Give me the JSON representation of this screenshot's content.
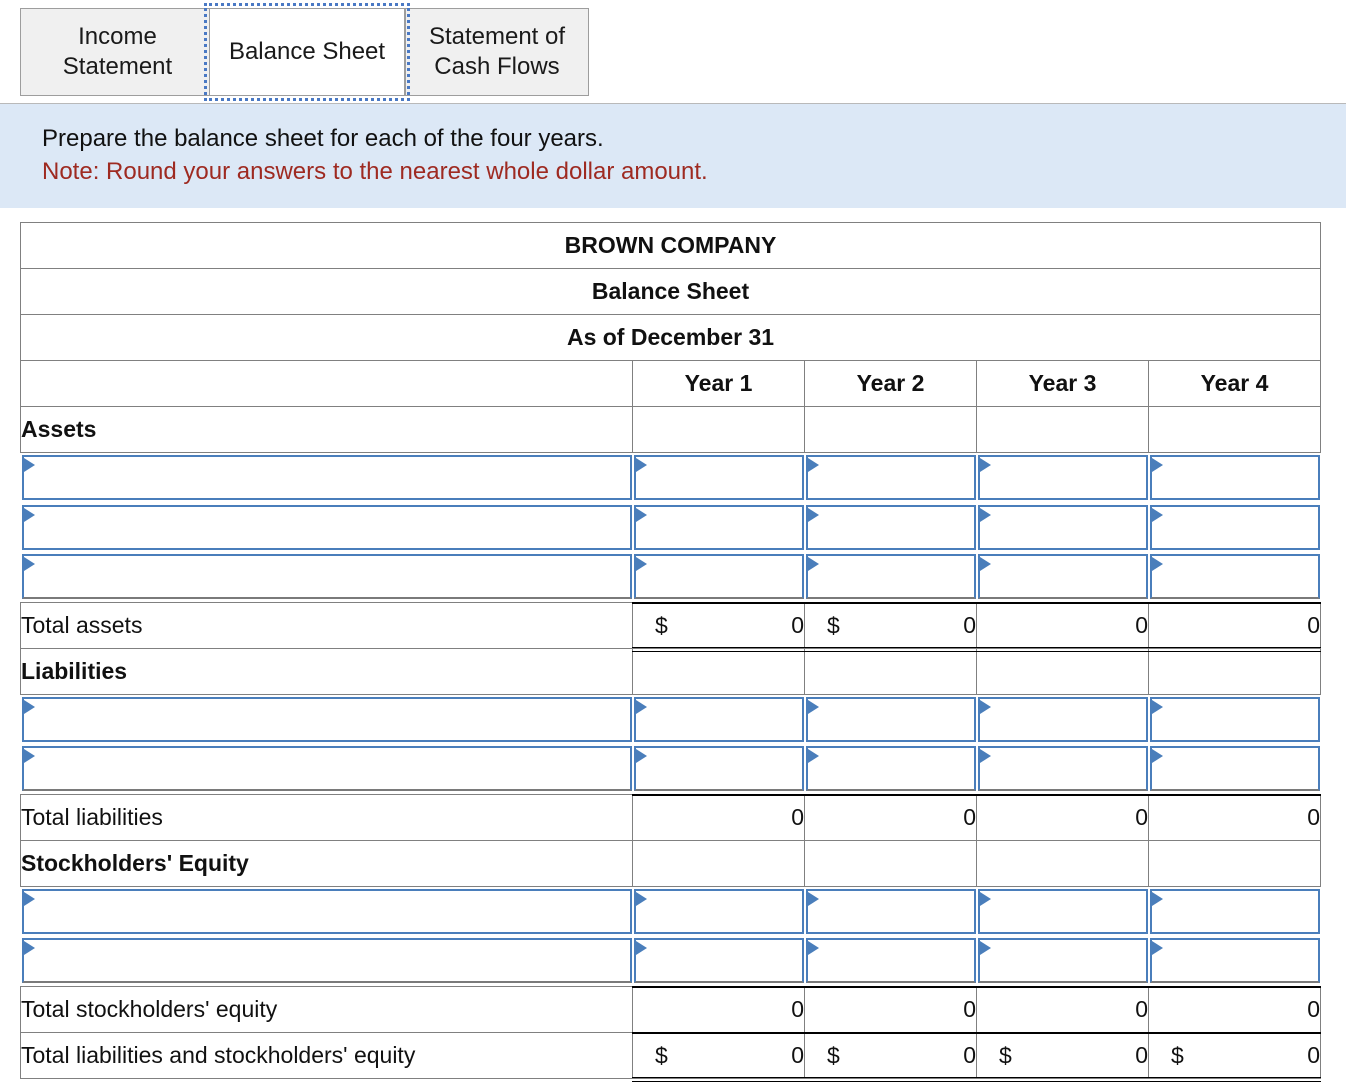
{
  "tabs": [
    {
      "label": "Income\nStatement",
      "active": false
    },
    {
      "label": "Balance Sheet",
      "active": true
    },
    {
      "label": "Statement of\nCash Flows",
      "active": false
    }
  ],
  "instructions": {
    "line1": "Prepare the balance sheet for each of the four years.",
    "note": "Note: Round your answers to the nearest whole dollar amount.",
    "note_color": "#9e2a21",
    "background": "#dce8f6"
  },
  "sheet": {
    "header_band_color": "#85aee0",
    "company": "BROWN COMPANY",
    "title": "Balance Sheet",
    "period": "As of December 31",
    "columns": [
      "Year 1",
      "Year 2",
      "Year 3",
      "Year 4"
    ],
    "sections": [
      {
        "heading": "Assets",
        "input_rows": 3,
        "total": {
          "label": "Total assets",
          "cells": [
            {
              "dollar": "$",
              "value": "0"
            },
            {
              "dollar": "$",
              "value": "0"
            },
            {
              "dollar": "",
              "value": "0"
            },
            {
              "dollar": "",
              "value": "0"
            }
          ],
          "double_underline": true
        }
      },
      {
        "heading": "Liabilities",
        "input_rows": 2,
        "total": {
          "label": "Total liabilities",
          "cells": [
            {
              "dollar": "",
              "value": "0"
            },
            {
              "dollar": "",
              "value": "0"
            },
            {
              "dollar": "",
              "value": "0"
            },
            {
              "dollar": "",
              "value": "0"
            }
          ],
          "double_underline": false
        }
      },
      {
        "heading": "Stockholders' Equity",
        "input_rows": 2,
        "total": {
          "label": "Total stockholders' equity",
          "cells": [
            {
              "dollar": "",
              "value": "0"
            },
            {
              "dollar": "",
              "value": "0"
            },
            {
              "dollar": "",
              "value": "0"
            },
            {
              "dollar": "",
              "value": "0"
            }
          ],
          "double_underline": false
        }
      }
    ],
    "grand_total": {
      "label": "Total liabilities and stockholders' equity",
      "cells": [
        {
          "dollar": "$",
          "value": "0"
        },
        {
          "dollar": "$",
          "value": "0"
        },
        {
          "dollar": "$",
          "value": "0"
        },
        {
          "dollar": "$",
          "value": "0"
        }
      ],
      "double_underline": true
    }
  }
}
